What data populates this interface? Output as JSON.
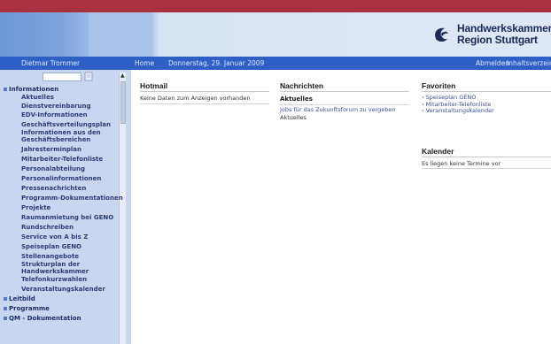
{
  "header": {
    "org_line1": "Handwerkskammer",
    "org_line2": "Region Stuttgart",
    "logo_icon": "hwk-logo-icon"
  },
  "navbar": {
    "user": "Dietmar Trommer",
    "home": "Home",
    "date": "Donnerstag, 29. Januar 2009",
    "logout": "Abmelden",
    "index": "Inhaltsverzeichn"
  },
  "sidebar": {
    "groups": [
      {
        "label": "Informationen",
        "expanded": true
      },
      {
        "label": "Leitbild"
      },
      {
        "label": "Programme"
      },
      {
        "label": "QM - Dokumentation"
      }
    ],
    "items": [
      "Aktuelles",
      "Dienstvereinbarung",
      "EDV-Informationen",
      "Geschäftsverteilungsplan",
      "Informationen aus den",
      "Geschäftsbereichen",
      "Jahresterminplan",
      "Mitarbeiter-Telefonliste",
      "Personalabteilung",
      "Personalinformationen",
      "Pressenachrichten",
      "Programm-Dokumentationen",
      "Projekte",
      "Raumanmietung bei GENO",
      "Rundschreiben",
      "Service von A bis Z",
      "Speiseplan GENO",
      "Stellenangebote",
      "Strukturplan der",
      "Handwerkskammer",
      "Telefonkurzwahlen",
      "Veranstaltungskalender"
    ]
  },
  "hotmail": {
    "title": "Hotmail",
    "empty": "Keine Daten zum Anzeigen vorhanden"
  },
  "nachrichten": {
    "title": "Nachrichten",
    "section": "Aktuelles",
    "link": "Jobs für das Zukunftsforum zu vergeben",
    "category": "Aktuelles"
  },
  "favoriten": {
    "title": "Favoriten",
    "links": [
      "Speiseplan GENO",
      "Mitarbeiter-Telefonliste",
      "Veranstaltungskalender"
    ]
  },
  "kalender": {
    "title": "Kalender",
    "empty": "Es liegen keine Termine vor"
  },
  "colors": {
    "top_stripe": "#a8313f",
    "navbar": "#2d5fc4",
    "sidebar": "#c9d6f0"
  }
}
